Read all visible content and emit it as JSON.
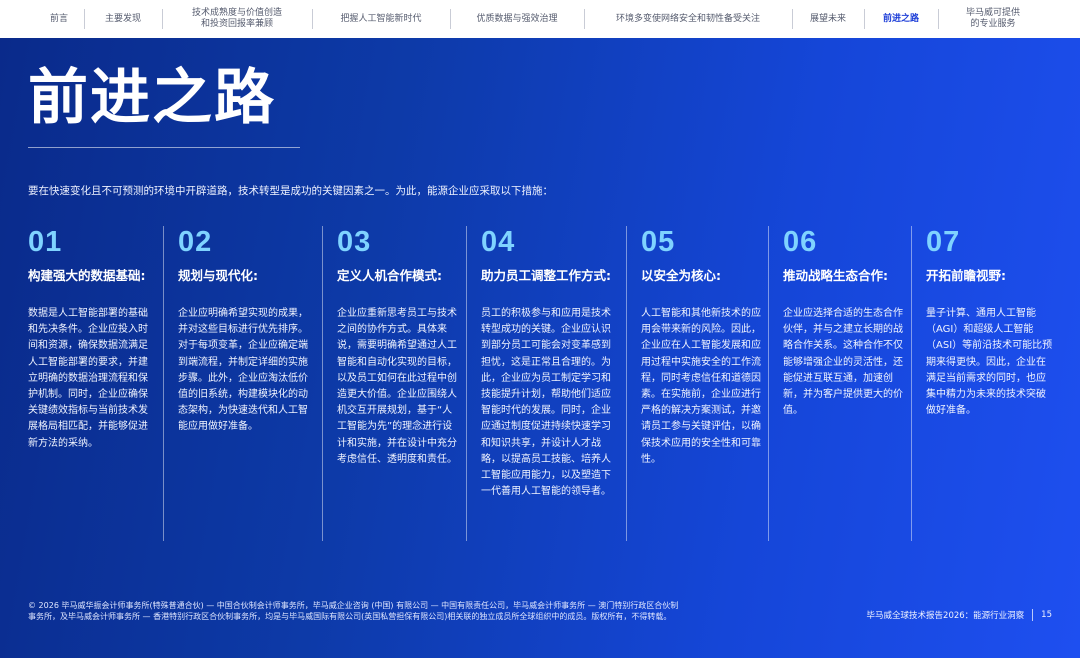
{
  "nav": {
    "items": [
      {
        "label": "前言",
        "active": false
      },
      {
        "label": "主要发现",
        "active": false
      },
      {
        "label": "技术成熟度与价值创造\n和投资回报率兼顾",
        "active": false
      },
      {
        "label": "把握人工智能新时代",
        "active": false
      },
      {
        "label": "优质数据与强效治理",
        "active": false
      },
      {
        "label": "环境多变使网络安全和韧性备受关注",
        "active": false
      },
      {
        "label": "展望未来",
        "active": false
      },
      {
        "label": "前进之路",
        "active": true
      },
      {
        "label": "毕马威可提供\n的专业服务",
        "active": false
      }
    ]
  },
  "page": {
    "title": "前进之路",
    "intro": "要在快速变化且不可预测的环境中开辟道路，技术转型是成功的关键因素之一。为此，能源企业应采取以下措施："
  },
  "steps": [
    {
      "number": "01",
      "heading": "构建强大的数据基础:",
      "body": "数据是人工智能部署的基础和先决条件。企业应投入时间和资源，确保数据流满足人工智能部署的要求，并建立明确的数据治理流程和保护机制。同时，企业应确保关键绩效指标与当前技术发展格局相匹配，并能够促进新方法的采纳。"
    },
    {
      "number": "02",
      "heading": "规划与现代化:",
      "body": "企业应明确希望实现的成果，并对这些目标进行优先排序。对于每项变革，企业应确定端到端流程，并制定详细的实施步骤。此外，企业应淘汰低价值的旧系统，构建模块化的动态架构，为快速迭代和人工智能应用做好准备。"
    },
    {
      "number": "03",
      "heading": "定义人机合作模式:",
      "body": "企业应重新思考员工与技术之间的协作方式。具体来说，需要明确希望通过人工智能和自动化实现的目标，以及员工如何在此过程中创造更大价值。企业应围绕人机交互开展规划，基于“人工智能为先”的理念进行设计和实施，并在设计中充分考虑信任、透明度和责任。"
    },
    {
      "number": "04",
      "heading": "助力员工调整工作方式:",
      "body": "员工的积极参与和应用是技术转型成功的关键。企业应认识到部分员工可能会对变革感到担忧，这是正常且合理的。为此，企业应为员工制定学习和技能提升计划，帮助他们适应智能时代的发展。同时，企业应通过制度促进持续快速学习和知识共享，并设计人才战略，以提高员工技能、培养人工智能应用能力，以及塑造下一代善用人工智能的领导者。"
    },
    {
      "number": "05",
      "heading": "以安全为核心:",
      "body": "人工智能和其他新技术的应用会带来新的风险。因此，企业应在人工智能发展和应用过程中实施安全的工作流程，同时考虑信任和道德因素。在实施前，企业应进行严格的解决方案测试，并邀请员工参与关键评估，以确保技术应用的安全性和可靠性。"
    },
    {
      "number": "06",
      "heading": "推动战略生态合作:",
      "body": "企业应选择合适的生态合作伙伴，并与之建立长期的战略合作关系。这种合作不仅能够增强企业的灵活性，还能促进互联互通，加速创新，并为客户提供更大的价值。"
    },
    {
      "number": "07",
      "heading": "开拓前瞻视野:",
      "body": "量子计算、通用人工智能（AGI）和超级人工智能（ASI）等前沿技术可能比预期来得更快。因此，企业在满足当前需求的同时，也应集中精力为未来的技术突破做好准备。"
    }
  ],
  "footer": {
    "legal": "© 2026 毕马威华振会计师事务所(特殊普通合伙) — 中国合伙制会计师事务所，毕马威企业咨询 (中国) 有限公司 — 中国有限责任公司，毕马威会计师事务所 — 澳门特别行政区合伙制事务所，及毕马威会计师事务所 — 香港特别行政区合伙制事务所，均是与毕马威国际有限公司(英国私营担保有限公司)相关联的独立成员所全球组织中的成员。版权所有，不得转载。",
    "report": "毕马威全球技术报告2026：能源行业洞察",
    "page_number": "15"
  }
}
